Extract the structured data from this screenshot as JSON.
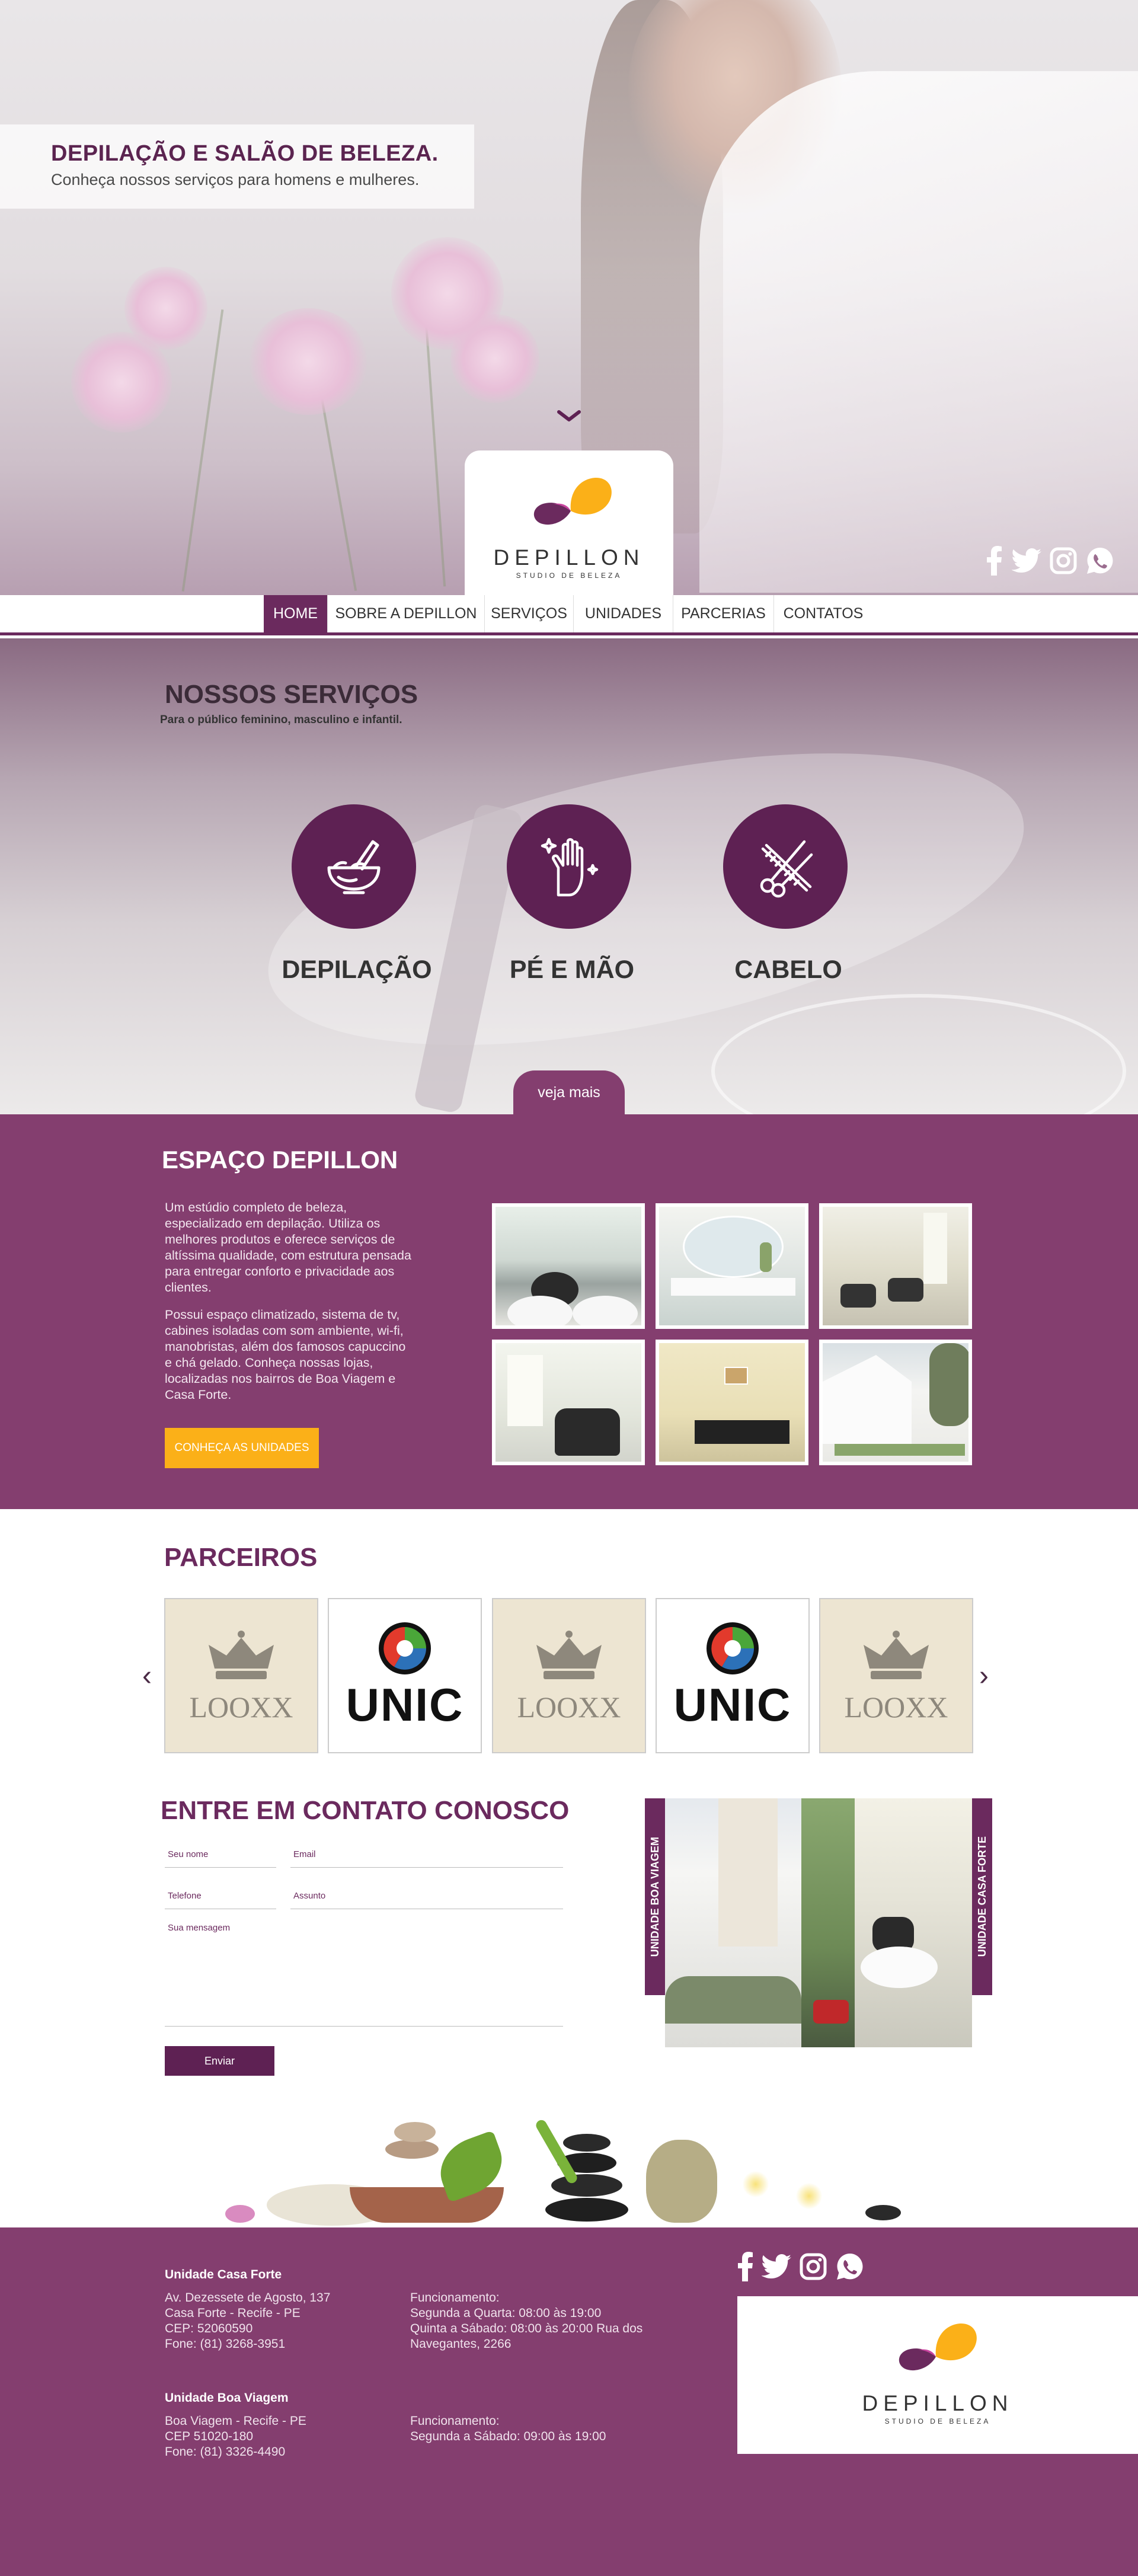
{
  "hero": {
    "title": "DEPILAÇÃO E SALÃO DE BELEZA.",
    "subtitle": "Conheça nossos serviços para homens e mulheres."
  },
  "brand": {
    "name": "DEPILLON",
    "tagline": "STUDIO DE BELEZA",
    "colors": {
      "primary": "#843e6f",
      "dark": "#5e2153",
      "accent": "#fbb018"
    }
  },
  "social": [
    "facebook-icon",
    "twitter-icon",
    "instagram-icon",
    "whatsapp-icon"
  ],
  "nav": {
    "items": [
      {
        "label": "HOME",
        "active": true
      },
      {
        "label": "SOBRE A DEPILLON"
      },
      {
        "label": "SERVIÇOS"
      },
      {
        "label": "UNIDADES"
      },
      {
        "label": "PARCERIAS"
      },
      {
        "label": "CONTATOS"
      }
    ]
  },
  "services": {
    "title": "NOSSOS SERVIÇOS",
    "subtitle": "Para o público feminino, masculino e infantil.",
    "items": [
      {
        "label": "DEPILAÇÃO",
        "icon": "wax-bowl-icon"
      },
      {
        "label": "PÉ E MÃO",
        "icon": "hand-sparkle-icon"
      },
      {
        "label": "CABELO",
        "icon": "scissors-comb-icon"
      }
    ],
    "more_label": "veja mais"
  },
  "espaco": {
    "title": "ESPAÇO DEPILLON",
    "paragraph1": "Um estúdio completo de beleza, especializado em depilação. Utiliza os melhores produtos e oferece serviços de altíssima qualidade, com estrutura pensada para entregar conforto e privacidade aos clientes.",
    "paragraph2": "Possui espaço climatizado, sistema de tv, cabines isoladas com som ambiente, wi-fi, manobristas, além dos famosos capuccino e chá gelado. Conheça nossas lojas, localizadas nos bairros de Boa Viagem e Casa Forte.",
    "button": "CONHEÇA AS UNIDADES"
  },
  "partners": {
    "title": "PARCEIROS",
    "items": [
      {
        "name": "LOOXX",
        "type": "looxx"
      },
      {
        "name": "UNIC",
        "type": "unic"
      },
      {
        "name": "LOOXX",
        "type": "looxx"
      },
      {
        "name": "UNIC",
        "type": "unic"
      },
      {
        "name": "LOOXX",
        "type": "looxx"
      }
    ],
    "prev": "‹",
    "next": "›"
  },
  "contact": {
    "title": "ENTRE EM CONTATO CONOSCO",
    "fields": {
      "name": "Seu nome",
      "email": "Email",
      "phone": "Telefone",
      "subject": "Assunto",
      "message": "Sua mensagem"
    },
    "submit": "Enviar",
    "unit_left": "UNIDADE BOA VIAGEM",
    "unit_right": "UNIDADE CASA FORTE"
  },
  "footer": {
    "casa_forte": {
      "title": "Unidade Casa Forte",
      "address": "Av. Dezessete de Agosto, 137\nCasa Forte - Recife - PE\nCEP: 52060590\nFone: (81) 3268-3951",
      "hours": "Funcionamento:\nSegunda a Quarta: 08:00 às 19:00\nQuinta a Sábado: 08:00 às 20:00 Rua dos Navegantes, 2266"
    },
    "boa_viagem": {
      "title": "Unidade Boa Viagem",
      "address": "Boa Viagem - Recife - PE\nCEP 51020-180\nFone: (81) 3326-4490",
      "hours": "Funcionamento:\nSegunda a Sábado: 09:00 às 19:00"
    }
  }
}
